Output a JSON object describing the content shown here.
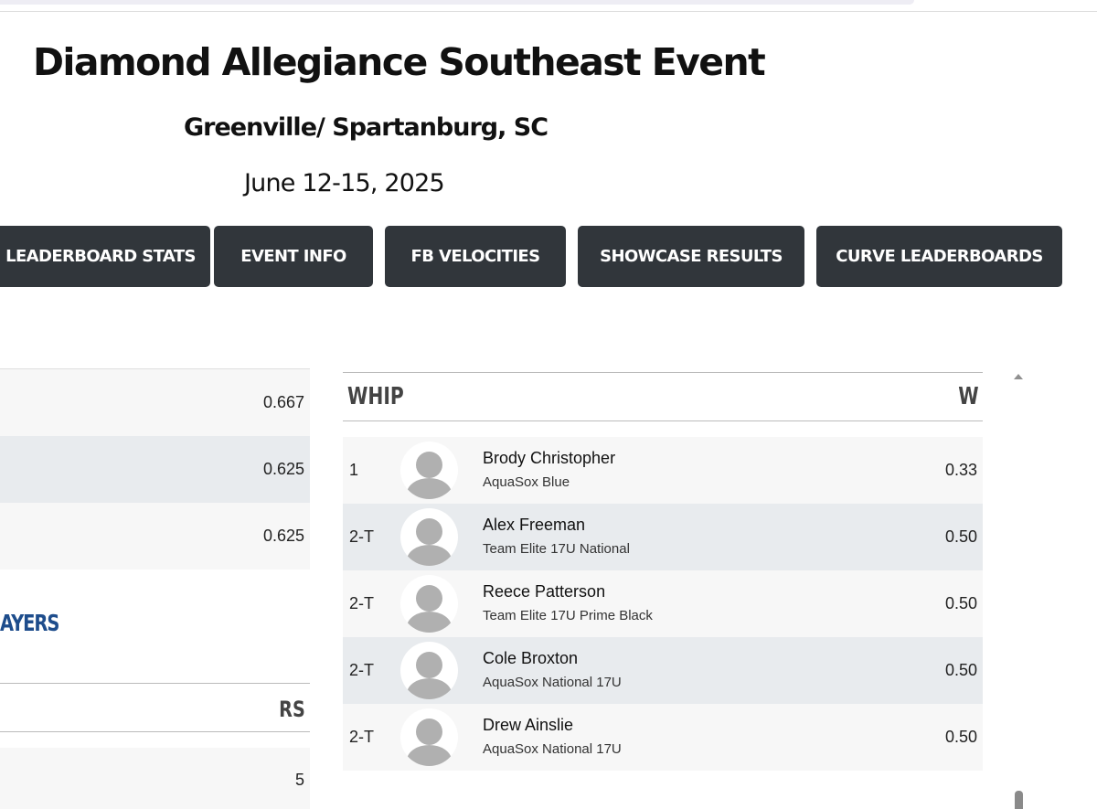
{
  "event": {
    "title": "Diamond Allegiance Southeast Event",
    "location": "Greenville/ Spartanburg, SC",
    "dates": "June 12-15, 2025"
  },
  "nav": {
    "buttons": [
      {
        "label": "LEADERBOARD STATS"
      },
      {
        "label": "EVENT INFO"
      },
      {
        "label": "FB VELOCITIES"
      },
      {
        "label": "SHOWCASE RESULTS"
      },
      {
        "label": "CURVE LEADERBOARDS"
      }
    ]
  },
  "left_panel": {
    "rows": [
      "0.667",
      "0.625",
      "0.625"
    ],
    "heading": "AYERS",
    "column": "RS",
    "last_value": "5"
  },
  "leaderboard": {
    "stat": "WHIP",
    "column": "W",
    "rows": [
      {
        "rank": "1",
        "name": "Brody Christopher",
        "team": "AquaSox Blue",
        "value": "0.33"
      },
      {
        "rank": "2-T",
        "name": "Alex Freeman",
        "team": "Team Elite 17U National",
        "value": "0.50"
      },
      {
        "rank": "2-T",
        "name": "Reece Patterson",
        "team": "Team Elite 17U Prime Black",
        "value": "0.50"
      },
      {
        "rank": "2-T",
        "name": "Cole Broxton",
        "team": "AquaSox National 17U",
        "value": "0.50"
      },
      {
        "rank": "2-T",
        "name": "Drew Ainslie",
        "team": "AquaSox National 17U",
        "value": "0.50"
      }
    ]
  },
  "icons": {
    "avatar": "user-placeholder-icon",
    "scroll_up": "scroll-up-arrow-icon"
  },
  "colors": {
    "button_bg": "#31363b",
    "heading_blue": "#1e4d8c",
    "row_alt": "#e8ebee"
  }
}
